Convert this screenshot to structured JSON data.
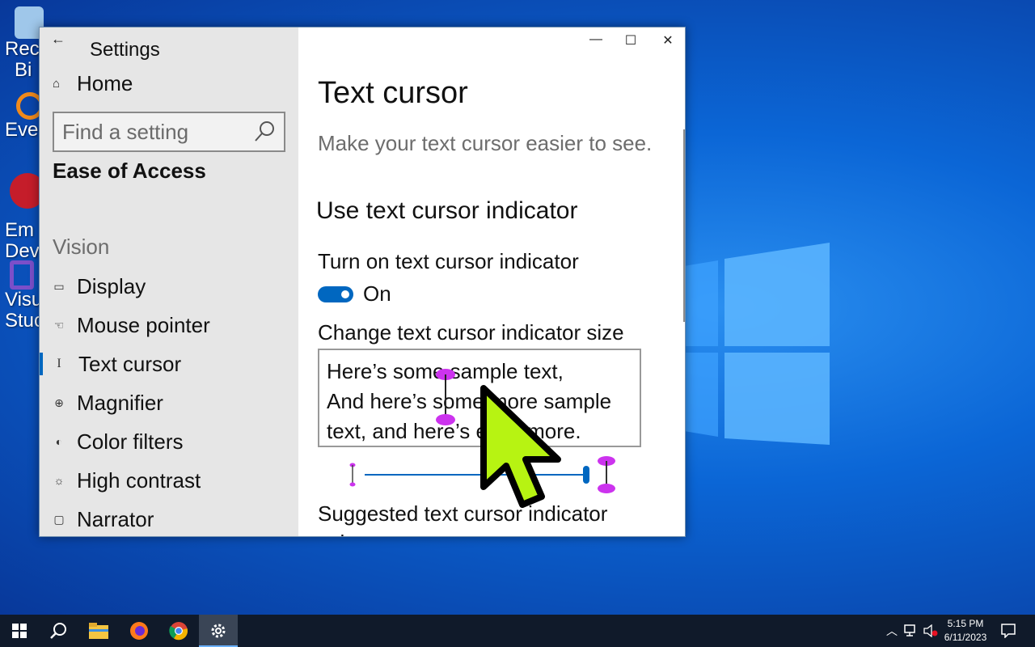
{
  "desktop": {
    "icons": [
      {
        "label": "Rec",
        "label2": "Bi",
        "color": "#9fc7ea"
      },
      {
        "label": "Eve",
        "color": "#f08a1c"
      },
      {
        "label": "Em",
        "label2": "Dev",
        "color": "#c51d2a"
      },
      {
        "label": "Visu",
        "label2": "Stuc",
        "color": "#7b4fc9"
      }
    ]
  },
  "window": {
    "app_title": "Settings",
    "back_icon": "back-arrow-icon",
    "controls": {
      "minimize": "—",
      "maximize": "☐",
      "close": "✕"
    }
  },
  "nav": {
    "home_label": "Home",
    "search_placeholder": "Find a setting",
    "section": "Ease of Access",
    "group": "Vision",
    "items": [
      {
        "label": "Display",
        "icon": "monitor-icon",
        "glyph": "▭"
      },
      {
        "label": "Mouse pointer",
        "icon": "mouse-pointer-icon",
        "glyph": "☜"
      },
      {
        "label": "Text cursor",
        "icon": "text-cursor-icon",
        "glyph": "I",
        "active": true
      },
      {
        "label": "Magnifier",
        "icon": "magnifier-icon",
        "glyph": "⊕"
      },
      {
        "label": "Color filters",
        "icon": "palette-icon",
        "glyph": "◐"
      },
      {
        "label": "High contrast",
        "icon": "sun-icon",
        "glyph": "☼"
      },
      {
        "label": "Narrator",
        "icon": "narrator-icon",
        "glyph": "▢"
      }
    ]
  },
  "content": {
    "title": "Text cursor",
    "subtitle": "Make your text cursor easier to see.",
    "section_heading": "Use text cursor indicator",
    "toggle_label": "Turn on text cursor indicator",
    "toggle_state": "On",
    "size_label": "Change text cursor indicator size",
    "sample_lines": [
      "Here’s some sample text,",
      "And here’s some more sample",
      "text, and here’s even more."
    ],
    "indicator_size_level": 1.0,
    "suggested_label": "Suggested text cursor indicator",
    "suggested_label_cont": "colors",
    "accent_color": "#0067c0",
    "indicator_color": "#cc33ee"
  },
  "taskbar": {
    "items": [
      "start-icon",
      "search-icon",
      "file-explorer-icon",
      "firefox-icon",
      "chrome-icon",
      "settings-icon"
    ],
    "time": "5:15 PM",
    "date": "6/11/2023"
  }
}
